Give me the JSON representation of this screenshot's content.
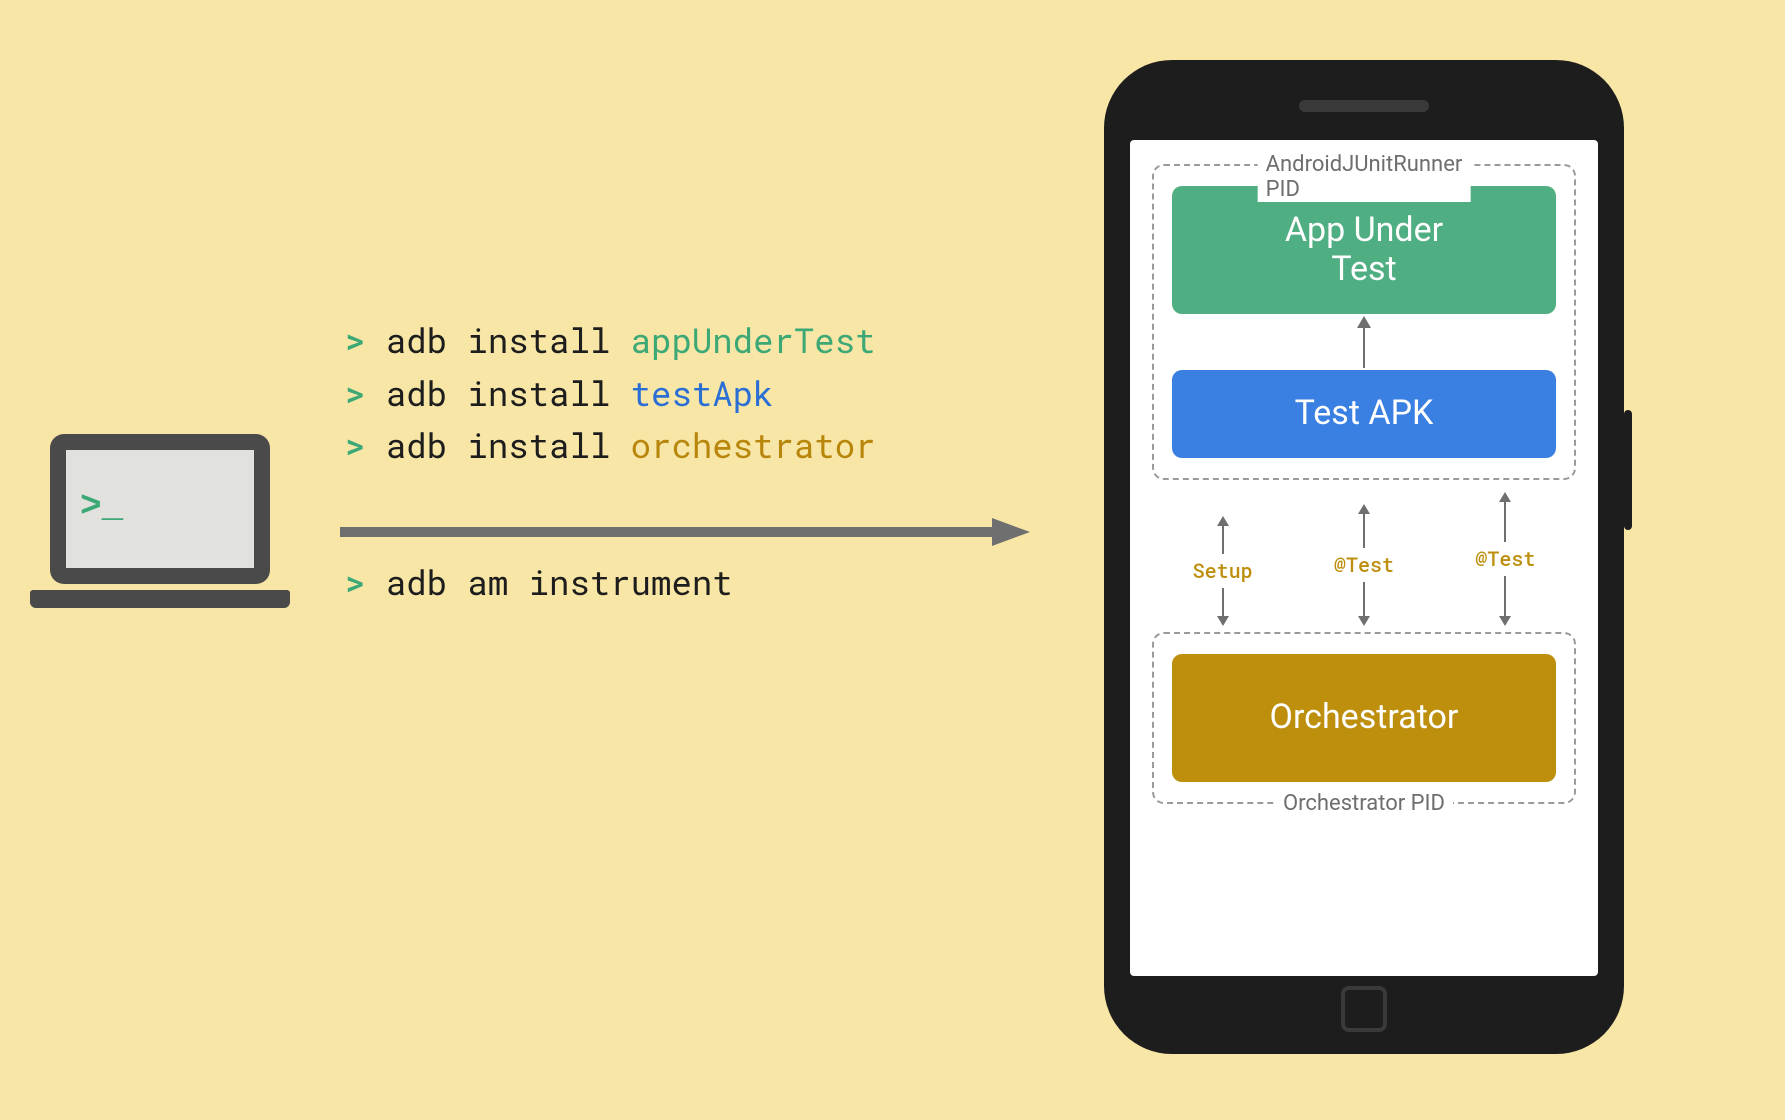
{
  "terminal": {
    "lines": [
      {
        "prompt": ">",
        "cmd": "adb install",
        "arg": "appUnderTest",
        "argClass": "arg-green"
      },
      {
        "prompt": ">",
        "cmd": "adb install",
        "arg": "testApk",
        "argClass": "arg-blue"
      },
      {
        "prompt": ">",
        "cmd": "adb install",
        "arg": "orchestrator",
        "argClass": "arg-gold"
      },
      {
        "prompt": ">",
        "cmd": "adb am instrument",
        "arg": "",
        "argClass": ""
      }
    ],
    "laptop_prompt": ">_"
  },
  "phone": {
    "runner_pid_label": "AndroidJUnitRunner PID",
    "orch_pid_label": "Orchestrator PID",
    "app_under_test": "App Under\nTest",
    "test_apk": "Test APK",
    "orchestrator": "Orchestrator",
    "flow": {
      "setup": "Setup",
      "test1": "@Test",
      "test2": "@Test"
    }
  },
  "colors": {
    "bg": "#f7e6a6",
    "green": "#4fae82",
    "blue": "#3a7fe2",
    "gold": "#bd8f0c",
    "arrow": "#6f6f6f"
  }
}
